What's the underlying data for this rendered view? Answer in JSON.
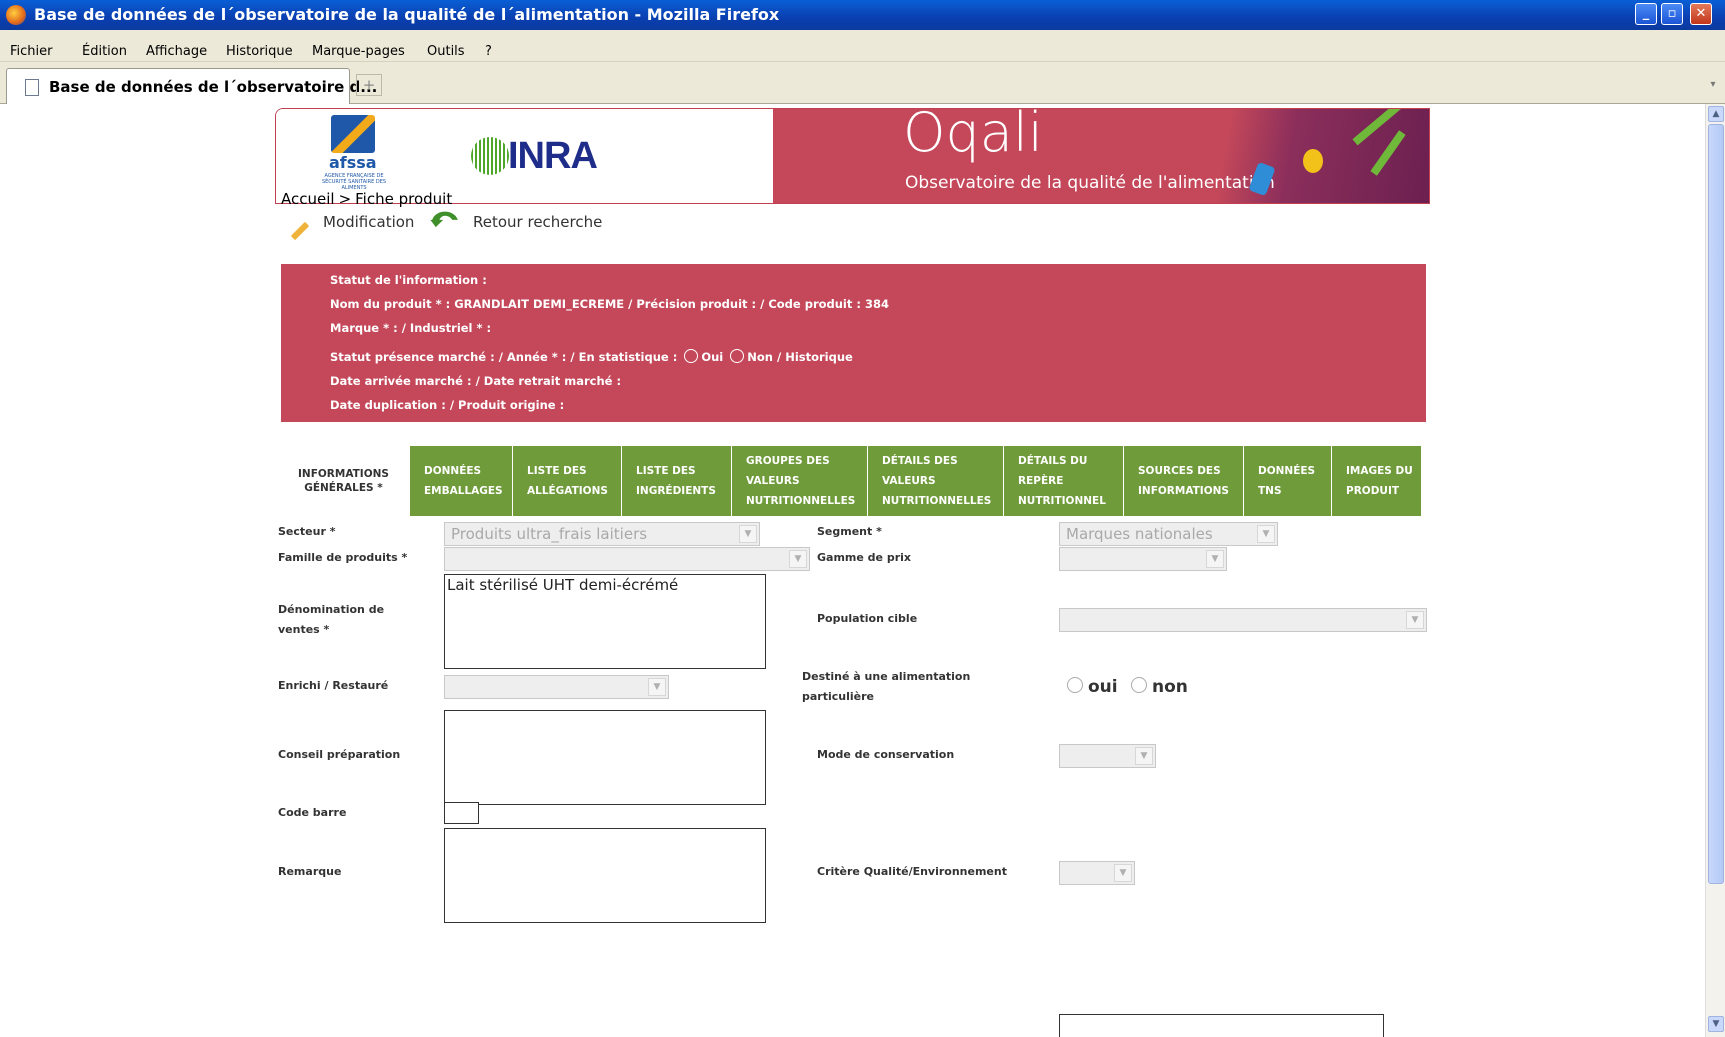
{
  "window": {
    "title": "Base de données de l´observatoire de la qualité de l´alimentation - Mozilla Firefox"
  },
  "menu": [
    "Fichier",
    "Édition",
    "Affichage",
    "Historique",
    "Marque-pages",
    "Outils",
    "?"
  ],
  "tab": {
    "title": "Base de données de l´observatoire d...",
    "new_tab": "+"
  },
  "banner": {
    "afssa": "afssa",
    "afssa_sub": "AGENCE FRANÇAISE DE SÉCURITÉ SANITAIRE DES ALIMENTS",
    "inra": "INRA",
    "oqali": "Oqali",
    "oqali_sub": "Observatoire de la qualité de l'alimentation"
  },
  "breadcrumb": {
    "home": "Accueil",
    "sep": ">",
    "current": "Fiche produit"
  },
  "actions": {
    "modification": "Modification",
    "retour": "Retour recherche"
  },
  "info": {
    "line1": "Statut de l'information :",
    "line2": "Nom du produit * : GRANDLAIT DEMI_ECREME / Précision produit : / Code produit : 384",
    "line3": "Marque * : / Industriel * :",
    "line4_a": "Statut présence marché : / Année * : / En statistique :",
    "line4_oui": "Oui",
    "line4_non": "Non",
    "line4_b": "/ Historique",
    "line5": "Date arrivée marché : / Date retrait marché :",
    "line6": "Date duplication : / Produit origine :"
  },
  "tabs": [
    {
      "label": "INFORMATIONS GÉNÉRALES *",
      "active": true
    },
    {
      "label": "DONNÉES EMBALLAGES"
    },
    {
      "label": "LISTE DES ALLÉGATIONS"
    },
    {
      "label": "LISTE DES INGRÉDIENTS"
    },
    {
      "label": "GROUPES DES VALEURS NUTRITIONNELLES"
    },
    {
      "label": "DÉTAILS DES VALEURS NUTRITIONNELLES"
    },
    {
      "label": "DÉTAILS DU REPÈRE NUTRITIONNEL"
    },
    {
      "label": "SOURCES DES INFORMATIONS"
    },
    {
      "label": "DONNÉES TNS"
    },
    {
      "label": "IMAGES DU PRODUIT"
    }
  ],
  "form": {
    "secteur_label": "Secteur *",
    "secteur_value": "Produits ultra_frais laitiers",
    "segment_label": "Segment *",
    "segment_value": "Marques nationales",
    "famille_label": "Famille de produits *",
    "gamme_label": "Gamme de prix",
    "denomination_label_1": "Dénomination de",
    "denomination_label_2": "ventes *",
    "denomination_value": "Lait stérilisé UHT demi-écrémé",
    "population_label": "Population cible",
    "enrichi_label": "Enrichi / Restauré",
    "destine_label_1": "Destiné à une alimentation",
    "destine_label_2": "particulière",
    "destine_oui": "oui",
    "destine_non": "non",
    "conseil_label": "Conseil préparation",
    "mode_label": "Mode de conservation",
    "code_barre_label": "Code barre",
    "remarque_label": "Remarque",
    "critere_label": "Critère Qualité/Environnement"
  }
}
